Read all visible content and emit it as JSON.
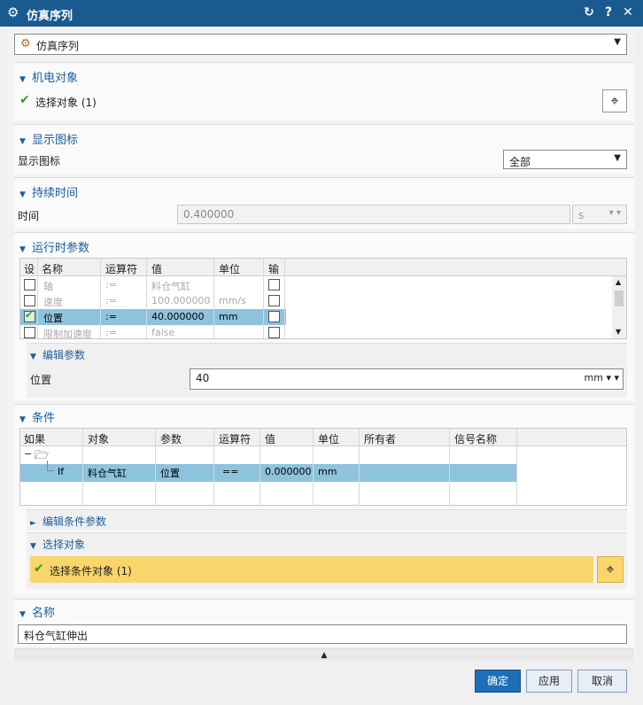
{
  "window": {
    "title": "仿真序列",
    "help_label": "?",
    "close_label": "✕",
    "reset_label": "↻"
  },
  "type_select": {
    "value": "仿真序列"
  },
  "mech_object": {
    "header": "机电对象",
    "select_label": "选择对象 (1)"
  },
  "display_icon": {
    "header": "显示图标",
    "label": "显示图标",
    "value": "全部"
  },
  "duration": {
    "header": "持续时间",
    "label": "时间",
    "value": "0.400000",
    "unit": "s"
  },
  "runtime_params": {
    "header": "运行时参数",
    "columns": [
      "设",
      "名称",
      "运算符",
      "值",
      "单位",
      "输"
    ],
    "rows": [
      {
        "name": "轴",
        "op": ":=",
        "value": "料仓气缸",
        "unit": "",
        "set": false,
        "out": false,
        "selected": false
      },
      {
        "name": "速度",
        "op": ":=",
        "value": "100.000000",
        "unit": "mm/s",
        "set": false,
        "out": false,
        "selected": false
      },
      {
        "name": "位置",
        "op": ":=",
        "value": "40.000000",
        "unit": "mm",
        "set": true,
        "out": false,
        "selected": true
      },
      {
        "name": "限制加速度",
        "op": ":=",
        "value": "false",
        "unit": "",
        "set": false,
        "out": false,
        "selected": false
      }
    ],
    "edit": {
      "header": "编辑参数",
      "label": "位置",
      "value": "40",
      "unit": "mm"
    }
  },
  "conditions": {
    "header": "条件",
    "columns": [
      "如果",
      "对象",
      "参数",
      "运算符",
      "值",
      "单位",
      "所有者",
      "信号名称"
    ],
    "row": {
      "if": "If",
      "object": "料仓气缸",
      "param": "位置",
      "op": "==",
      "value": "0.000000",
      "unit": "mm",
      "owner": "",
      "signal": ""
    },
    "edit_header": "编辑条件参数",
    "select_header": "选择对象",
    "select_label": "选择条件对象 (1)"
  },
  "name_section": {
    "header": "名称",
    "value": "料仓气缸伸出"
  },
  "footer": {
    "ok_label": "确定",
    "apply_label": "应用",
    "cancel_label": "取消"
  },
  "colors": {
    "titlebar": "#1a5a8f",
    "section_header": "#1d5e9a",
    "selected_row": "#8ec3de",
    "highlight": "#f9d66b",
    "primary_button": "#1d6fb8"
  },
  "icons": [
    "gear-icon",
    "reset-icon",
    "help-icon",
    "close-icon",
    "sequence-icon",
    "check-icon",
    "crosshair-icon",
    "folder-icon"
  ]
}
